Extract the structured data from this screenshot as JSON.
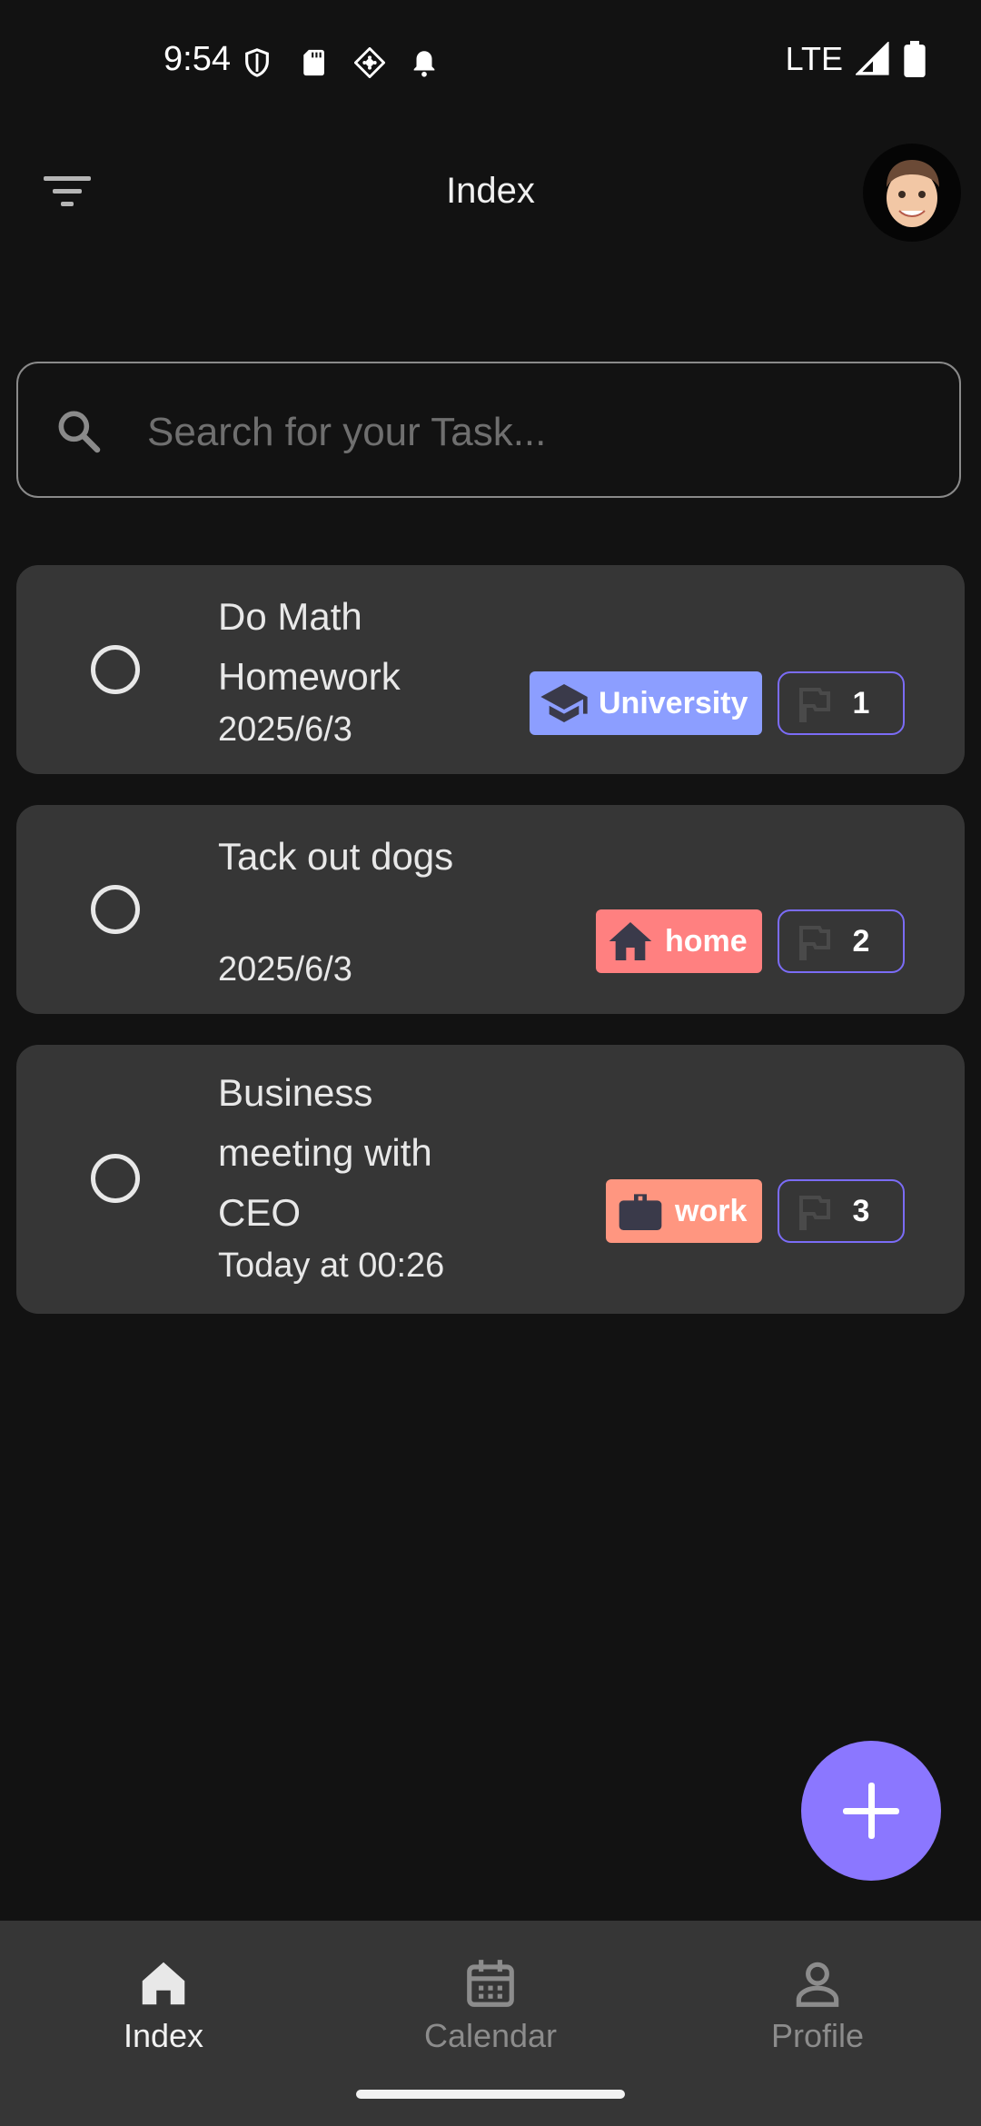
{
  "status_bar": {
    "time": "9:54",
    "network": "LTE"
  },
  "app_bar": {
    "title": "Index"
  },
  "search": {
    "placeholder": "Search for your Task..."
  },
  "tasks": [
    {
      "title": "Do Math Homework",
      "date": "2025/6/3",
      "category": "University",
      "category_icon": "graduation-cap-icon",
      "category_color": "#8c9eff",
      "priority": "1"
    },
    {
      "title": "Tack out dogs",
      "date": "2025/6/3",
      "category": "home",
      "category_icon": "home-icon",
      "category_color": "#ff8080",
      "priority": "2"
    },
    {
      "title": "Business meeting with CEO",
      "date": "Today at 00:26",
      "category": "work",
      "category_icon": "briefcase-icon",
      "category_color": "#ff9680",
      "priority": "3"
    }
  ],
  "fab": {
    "icon": "plus-icon",
    "color": "#8b77ff"
  },
  "bottom_nav": {
    "items": [
      {
        "label": "Index",
        "icon": "home-icon",
        "active": true
      },
      {
        "label": "Calendar",
        "icon": "calendar-icon",
        "active": false
      },
      {
        "label": "Profile",
        "icon": "person-icon",
        "active": false
      }
    ]
  },
  "colors": {
    "background": "#121212",
    "card": "#363636",
    "accent": "#7b6cf6"
  }
}
